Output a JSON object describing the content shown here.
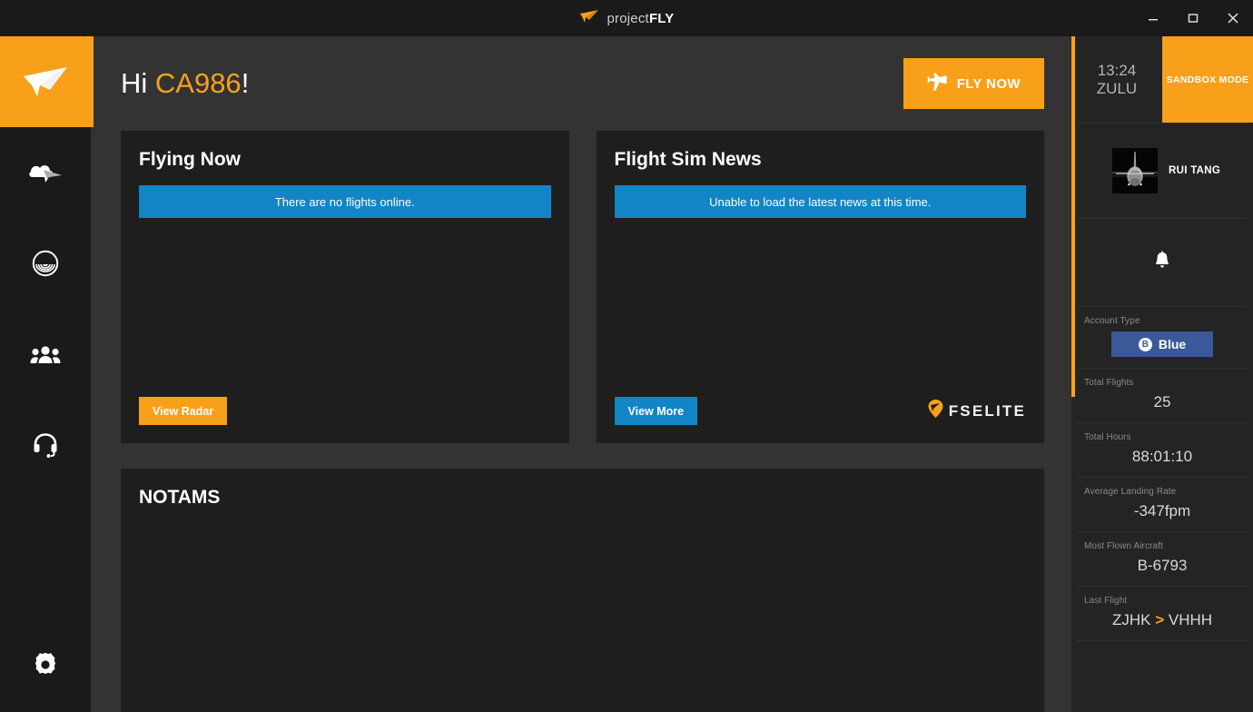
{
  "window": {
    "app_title_light": "project",
    "app_title_bold": "FLY",
    "minimize_label": "–",
    "maximize_label": "□",
    "close_label": "✕",
    "logo_icon": "paper-plane-icon"
  },
  "sidebar": {
    "logo_icon": "paper-plane-logo-icon",
    "items": [
      {
        "icon": "cloud-plane-icon",
        "name": "flights"
      },
      {
        "icon": "radar-icon",
        "name": "radar"
      },
      {
        "icon": "group-people-icon",
        "name": "community"
      },
      {
        "icon": "headset-icon",
        "name": "support"
      }
    ],
    "bottom": {
      "icon": "gear-icon",
      "name": "settings"
    }
  },
  "header": {
    "greeting_prefix": "Hi ",
    "username": "CA986",
    "greeting_suffix": "!",
    "fly_now_label": "FLY NOW",
    "fly_now_icon": "airplane-icon"
  },
  "cards": {
    "flying_now": {
      "title": "Flying Now",
      "alert": "There are no flights online.",
      "button_label": "View Radar"
    },
    "flight_sim_news": {
      "title": "Flight Sim News",
      "alert": "Unable to load the latest news at this time.",
      "button_label": "View More",
      "sponsor_logo_text": "FSELITE",
      "sponsor_logo_icon": "fselite-pin-icon"
    }
  },
  "notams": {
    "title": "NOTAMS"
  },
  "right_panel": {
    "clock_time": "13:24",
    "clock_zone": "ZULU",
    "sandbox_label": "SANDBOX MODE",
    "user_name": "RUI TANG",
    "avatar_icon": "aircraft-avatar-image",
    "bell_icon": "notification-bell-icon",
    "stats": [
      {
        "label": "Account Type",
        "value": "Blue",
        "badge_letter": "B",
        "type": "badge"
      },
      {
        "label": "Total Flights",
        "value": "25",
        "type": "text"
      },
      {
        "label": "Total Hours",
        "value": "88:01:10",
        "type": "text"
      },
      {
        "label": "Average Landing Rate",
        "value": "-347fpm",
        "type": "text"
      },
      {
        "label": "Most Flown Aircraft",
        "value": "B-6793",
        "type": "text"
      },
      {
        "label": "Last Flight",
        "value_from": "ZJHK",
        "separator": ">",
        "value_to": "VHHH",
        "type": "route"
      }
    ]
  },
  "colors": {
    "accent_orange": "#F9A01B",
    "alert_blue": "#1185c6",
    "badge_blue": "#3b5998",
    "panel_bg": "#242424",
    "card_bg": "#1e1e1e",
    "page_bg": "#333333",
    "chrome_bg": "#1a1a1a"
  }
}
